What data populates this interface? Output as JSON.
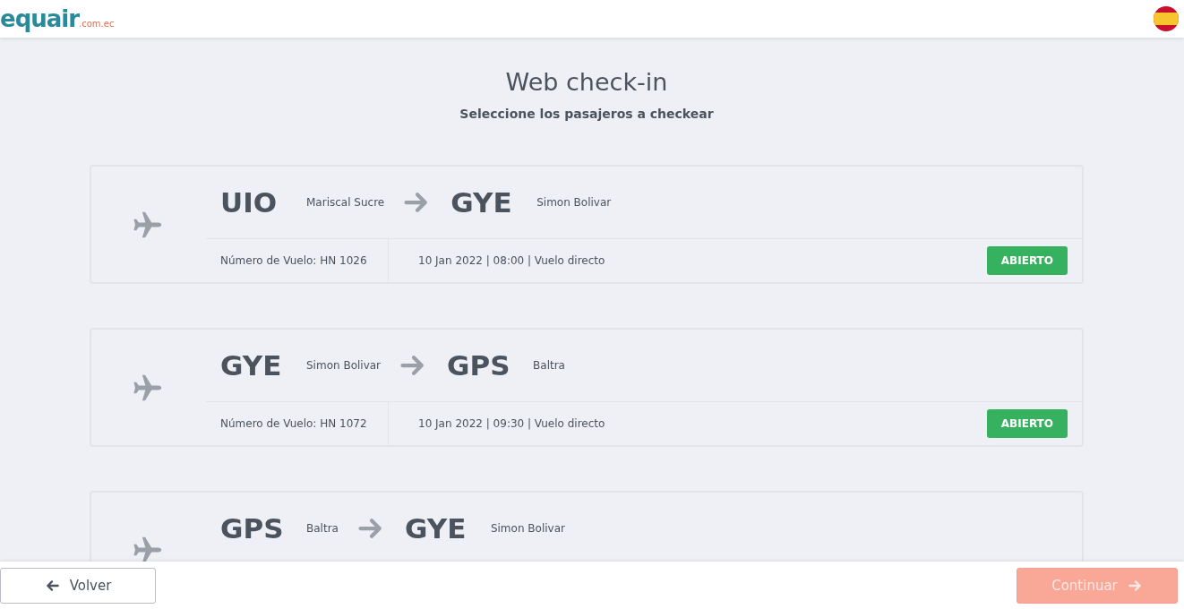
{
  "header": {
    "logo": {
      "name": "equair",
      "domain": ".com.ec"
    }
  },
  "page": {
    "title": "Web check-in",
    "subtitle": "Seleccione los pasajeros a checkear"
  },
  "flights": [
    {
      "origin": {
        "code": "UIO",
        "airport": "Mariscal Sucre"
      },
      "destination": {
        "code": "GYE",
        "airport": "Simon Bolivar"
      },
      "flight_number": "Número de Vuelo: HN 1026",
      "schedule": "10 Jan 2022 | 08:00 | Vuelo directo",
      "status": "ABIERTO"
    },
    {
      "origin": {
        "code": "GYE",
        "airport": "Simon Bolivar"
      },
      "destination": {
        "code": "GPS",
        "airport": "Baltra"
      },
      "flight_number": "Número de Vuelo: HN 1072",
      "schedule": "10 Jan 2022 | 09:30 | Vuelo directo",
      "status": "ABIERTO"
    },
    {
      "origin": {
        "code": "GPS",
        "airport": "Baltra"
      },
      "destination": {
        "code": "GYE",
        "airport": "Simon Bolivar"
      }
    }
  ],
  "footer": {
    "back": {
      "label": "Volver"
    },
    "continue": {
      "label": "Continuar",
      "disabled": true
    }
  }
}
